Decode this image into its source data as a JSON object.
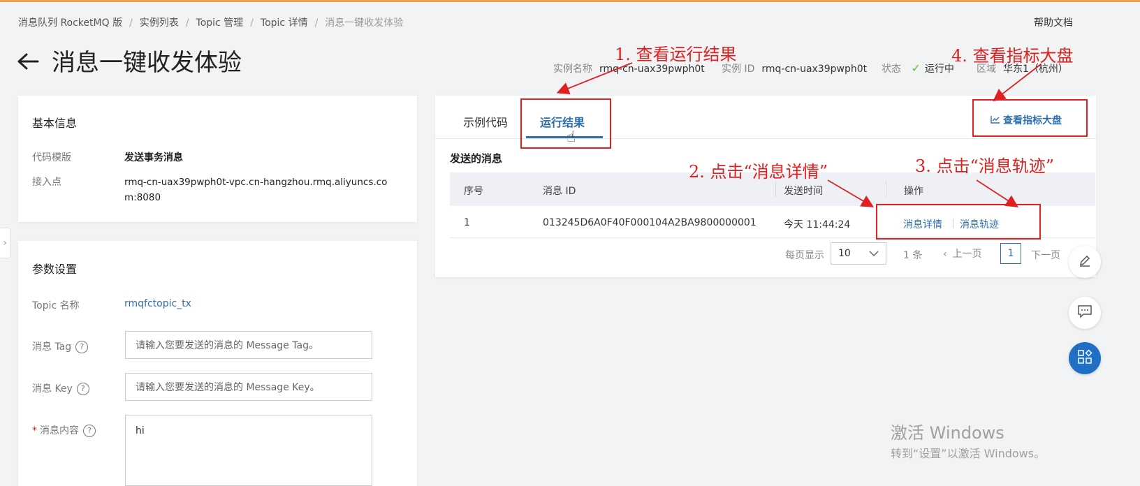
{
  "breadcrumb": {
    "items": [
      "消息队列 RocketMQ 版",
      "实例列表",
      "Topic 管理",
      "Topic 详情"
    ],
    "current": "消息一键收发体验"
  },
  "header": {
    "help_link": "帮助文档",
    "title": "消息一键收发体验",
    "instance_name_label": "实例名称",
    "instance_name_value": "rmq-cn-uax39pwph0t",
    "instance_id_label": "实例 ID",
    "instance_id_value": "rmq-cn-uax39pwph0t",
    "status_label": "状态",
    "status_value": "运行中",
    "region_label": "区域",
    "region_value": "华东1（杭州）"
  },
  "basic_info": {
    "title": "基本信息",
    "template_label": "代码模版",
    "template_value": "发送事务消息",
    "endpoint_label": "接入点",
    "endpoint_value_line1": "rmq-cn-uax39pwph0t-vpc.cn-hangzhou.rmq.aliyuncs.co",
    "endpoint_value_line2": "m:8080"
  },
  "params": {
    "title": "参数设置",
    "topic_label": "Topic 名称",
    "topic_value": "rmqfctopic_tx",
    "tag_label": "消息 Tag",
    "tag_placeholder": "请输入您要发送的消息的 Message Tag。",
    "key_label": "消息 Key",
    "key_placeholder": "请输入您要发送的消息的 Message Key。",
    "content_required": "*",
    "content_label": "消息内容",
    "content_value": "hi"
  },
  "result_panel": {
    "tabs": [
      "示例代码",
      "运行结果"
    ],
    "active_tab": "运行结果",
    "dashboard_button": "查看指标大盘",
    "section_title": "发送的消息",
    "columns": [
      "序号",
      "消息 ID",
      "发送时间",
      "操作"
    ],
    "rows": [
      {
        "index": "1",
        "message_id": "013245D6A0F40F000104A2BA9800000001",
        "time": "今天 11:44:24",
        "action_detail": "消息详情",
        "action_trace": "消息轨迹"
      }
    ],
    "pagination": {
      "page_size_label": "每页显示",
      "page_size": "10",
      "total": "1 条",
      "prev": "上一页",
      "current_page": "1",
      "next": "下一页"
    }
  },
  "annotations": {
    "step1": "1. 查看运行结果",
    "step2": "2. 点击“消息详情”",
    "step3": "3. 点击“消息轨迹”",
    "step4": "4. 查看指标大盘",
    "color": "#e02020"
  },
  "watermark": {
    "line1": "激活 Windows",
    "line2": "转到“设置”以激活 Windows。"
  },
  "colors": {
    "accent_blue": "#2f6fb0",
    "status_green": "#52c41a",
    "float_blue": "#1f6fc5"
  }
}
